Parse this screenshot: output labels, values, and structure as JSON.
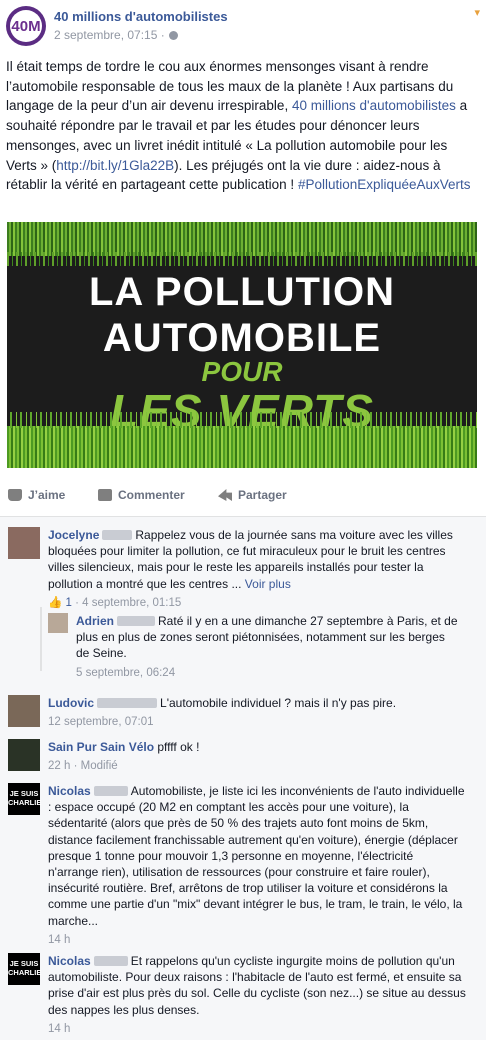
{
  "post": {
    "page_name": "40 millions d'automobilistes",
    "date": "2 septembre, 07:15",
    "avatar_text": "40M",
    "text_before_link": "Il était temps de tordre le cou aux énormes mensonges visant à rendre l’automobile responsable de tous les maux de la planète ! Aux partisans du langage de la peur d’un air devenu irrespirable, ",
    "mention": "40 millions d'automobilistes",
    "text_middle": " a souhaité répondre par le travail et par les études pour dénoncer leurs mensonges, avec un livret inédit intitulé « La pollution automobile pour les Verts » (",
    "url": "http://bit.ly/1Gla22B",
    "text_after": "). Les préjugés ont la vie dure : aidez-nous à rétablir la vérité en partageant cette publication ! ",
    "hashtag": "#PollutionExpliquéeAuxVerts",
    "image": {
      "line1": "LA POLLUTION",
      "line2": "AUTOMOBILE",
      "line3": "POUR",
      "line4": "LES VERTS"
    }
  },
  "actions": {
    "like": "J’aime",
    "comment": "Commenter",
    "share": "Partager"
  },
  "comments": [
    {
      "author": "Jocelyne",
      "text": "Rappelez vous de la journée sans ma voiture avec les villes bloquées pour limiter la pollution, ce fut miraculeux pour le bruit les centres villes silencieux, mais pour le reste les appareils installés pour tester la pollution a montré que les centres ...",
      "more": "Voir plus",
      "likes": "1",
      "date": "4 septembre, 01:15",
      "avatar_color": "#8a6a60"
    },
    {
      "author": "Adrien",
      "text": "Raté il y en a une dimanche 27 septembre à Paris, et de plus en plus de zones seront piétonnisées, notamment sur les berges de Seine.",
      "date": "5 septembre, 06:24",
      "avatar_color": "#b8a898"
    },
    {
      "author": "Ludovic",
      "text": "L'automobile individuel ? mais il n'y pas pire.",
      "date": "12 septembre, 07:01",
      "avatar_color": "#7a6858"
    },
    {
      "author": "Sain Pur Sain Vélo",
      "text": "pffff ok !",
      "date": "22 h",
      "modified": "Modifié",
      "avatar_color": "#2a3326"
    },
    {
      "author": "Nicolas",
      "text": "Automobiliste, je liste ici les inconvénients de l'auto individuelle : espace occupé (20 M2 en comptant les accès pour une voiture), la sédentarité (alors que près de 50 % des trajets auto font moins de 5km, distance facilement franchissable autrement qu'en voiture), énergie (déplacer presque 1 tonne pour mouvoir 1,3 personne en moyenne, l'électricité n'arrange rien), utilisation de ressources (pour construire et faire rouler), insécurité routière. Bref, arrêtons de trop utiliser la voiture et considérons la comme une partie d'un \"mix\" devant intégrer le bus, le tram, le train, le vélo, la marche...",
      "date": "14 h",
      "avatar_text": "JE SUIS CHARLIE"
    },
    {
      "author": "Nicolas",
      "text": "Et rappelons qu'un cycliste ingurgite moins de pollution qu'un automobiliste. Pour deux raisons : l'habitacle de l'auto est fermé, et ensuite sa prise d'air est plus près du sol. Celle du cycliste (son nez...) se situe au dessus des nappes les plus denses.",
      "date": "14 h",
      "avatar_text": "JE SUIS CHARLIE"
    }
  ]
}
